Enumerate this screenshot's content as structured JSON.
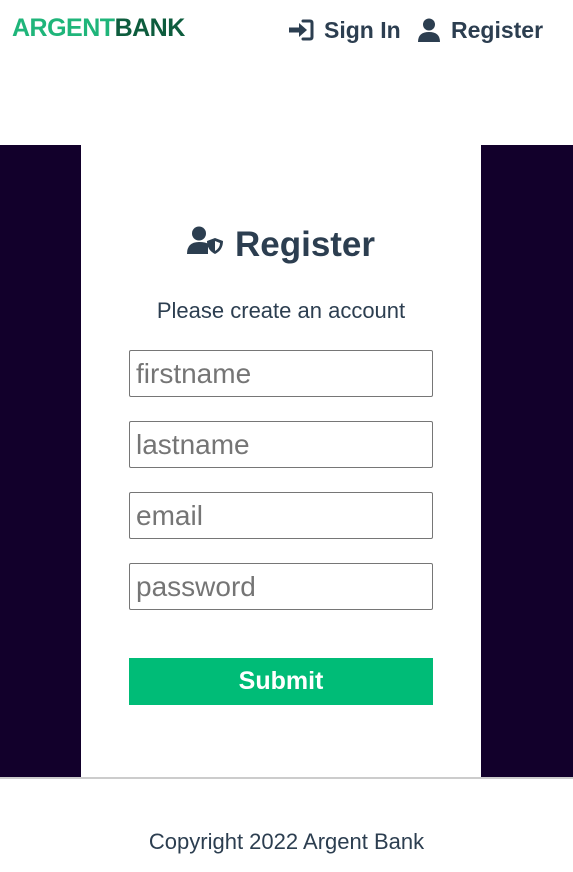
{
  "header": {
    "logo_part1": "ARGENT",
    "logo_part2": "BANK",
    "logo_colors": {
      "part1": "#1fb57a",
      "part2": "#0d5c3d"
    },
    "nav": [
      {
        "label": "Sign In",
        "icon": "sign-in-icon"
      },
      {
        "label": "Register",
        "icon": "user-icon"
      }
    ]
  },
  "form": {
    "title": "Register",
    "title_icon": "user-shield-icon",
    "subtitle": "Please create an account",
    "fields": [
      {
        "placeholder": "firstname",
        "value": ""
      },
      {
        "placeholder": "lastname",
        "value": ""
      },
      {
        "placeholder": "email",
        "value": ""
      },
      {
        "placeholder": "password",
        "value": ""
      }
    ],
    "submit_label": "Submit"
  },
  "footer": {
    "copyright": "Copyright 2022 Argent Bank"
  },
  "colors": {
    "accent": "#00bc77",
    "background_dark": "#12002b",
    "text": "#2c3e50"
  }
}
